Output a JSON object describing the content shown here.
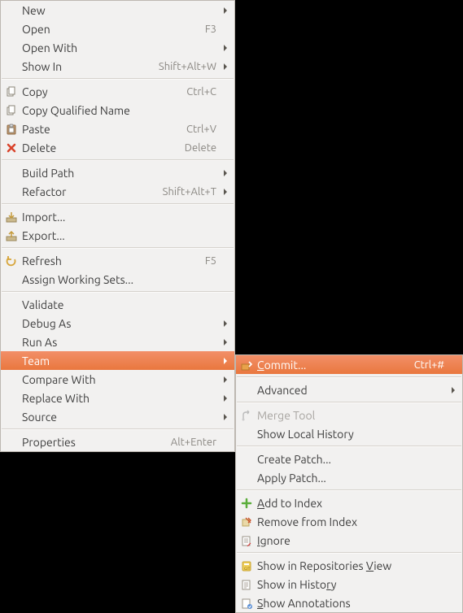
{
  "main_menu": {
    "groups": [
      [
        {
          "id": "new",
          "label": "New",
          "shortcut": "",
          "submenu": true,
          "icon": "",
          "name": "menu-item-new"
        },
        {
          "id": "open",
          "label": "Open",
          "shortcut": "F3",
          "submenu": false,
          "icon": "",
          "name": "menu-item-open"
        },
        {
          "id": "openwith",
          "label": "Open With",
          "shortcut": "",
          "submenu": true,
          "icon": "",
          "name": "menu-item-open-with"
        },
        {
          "id": "showin",
          "label": "Show In",
          "shortcut": "Shift+Alt+W",
          "submenu": true,
          "icon": "",
          "name": "menu-item-show-in"
        }
      ],
      [
        {
          "id": "copy",
          "label": "Copy",
          "shortcut": "Ctrl+C",
          "submenu": false,
          "icon": "copy",
          "name": "menu-item-copy"
        },
        {
          "id": "copyqn",
          "label": "Copy Qualified Name",
          "shortcut": "",
          "submenu": false,
          "icon": "copy",
          "name": "menu-item-copy-qualified-name"
        },
        {
          "id": "paste",
          "label": "Paste",
          "shortcut": "Ctrl+V",
          "submenu": false,
          "icon": "paste",
          "name": "menu-item-paste"
        },
        {
          "id": "delete",
          "label": "Delete",
          "shortcut": "Delete",
          "submenu": false,
          "icon": "delete",
          "name": "menu-item-delete"
        }
      ],
      [
        {
          "id": "buildpath",
          "label": "Build Path",
          "shortcut": "",
          "submenu": true,
          "icon": "",
          "name": "menu-item-build-path"
        },
        {
          "id": "refactor",
          "label": "Refactor",
          "shortcut": "Shift+Alt+T",
          "submenu": true,
          "icon": "",
          "name": "menu-item-refactor"
        }
      ],
      [
        {
          "id": "import",
          "label": "Import...",
          "shortcut": "",
          "submenu": false,
          "icon": "import",
          "name": "menu-item-import"
        },
        {
          "id": "export",
          "label": "Export...",
          "shortcut": "",
          "submenu": false,
          "icon": "export",
          "name": "menu-item-export"
        }
      ],
      [
        {
          "id": "refresh",
          "label": "Refresh",
          "shortcut": "F5",
          "submenu": false,
          "icon": "refresh",
          "name": "menu-item-refresh"
        },
        {
          "id": "aws",
          "label": "Assign Working Sets...",
          "shortcut": "",
          "submenu": false,
          "icon": "",
          "name": "menu-item-assign-working-sets"
        }
      ],
      [
        {
          "id": "validate",
          "label": "Validate",
          "shortcut": "",
          "submenu": false,
          "icon": "",
          "name": "menu-item-validate"
        },
        {
          "id": "debugas",
          "label": "Debug As",
          "shortcut": "",
          "submenu": true,
          "icon": "",
          "name": "menu-item-debug-as"
        },
        {
          "id": "runas",
          "label": "Run As",
          "shortcut": "",
          "submenu": true,
          "icon": "",
          "name": "menu-item-run-as"
        },
        {
          "id": "team",
          "label": "Team",
          "shortcut": "",
          "submenu": true,
          "icon": "",
          "name": "menu-item-team",
          "highlight": true
        },
        {
          "id": "compare",
          "label": "Compare With",
          "shortcut": "",
          "submenu": true,
          "icon": "",
          "name": "menu-item-compare-with"
        },
        {
          "id": "replace",
          "label": "Replace With",
          "shortcut": "",
          "submenu": true,
          "icon": "",
          "name": "menu-item-replace-with"
        },
        {
          "id": "source",
          "label": "Source",
          "shortcut": "",
          "submenu": true,
          "icon": "",
          "name": "menu-item-source"
        }
      ],
      [
        {
          "id": "properties",
          "label": "Properties",
          "shortcut": "Alt+Enter",
          "submenu": false,
          "icon": "",
          "name": "menu-item-properties"
        }
      ]
    ]
  },
  "sub_menu": {
    "groups": [
      [
        {
          "id": "commit",
          "label": "Commit...",
          "mnemonic": "C",
          "shortcut": "Ctrl+#",
          "submenu": false,
          "icon": "commit",
          "name": "menu-item-commit",
          "highlight": true
        }
      ],
      [
        {
          "id": "advanced",
          "label": "Advanced",
          "mnemonic": "",
          "shortcut": "",
          "submenu": true,
          "icon": "",
          "name": "menu-item-advanced"
        }
      ],
      [
        {
          "id": "mergetool",
          "label": "Merge Tool",
          "mnemonic": "",
          "shortcut": "",
          "submenu": false,
          "icon": "merge",
          "name": "menu-item-merge-tool",
          "disabled": true
        },
        {
          "id": "showlocal",
          "label": "Show Local History",
          "mnemonic": "",
          "shortcut": "",
          "submenu": false,
          "icon": "",
          "name": "menu-item-show-local-history"
        }
      ],
      [
        {
          "id": "createpatch",
          "label": "Create Patch...",
          "mnemonic": "",
          "shortcut": "",
          "submenu": false,
          "icon": "",
          "name": "menu-item-create-patch"
        },
        {
          "id": "applypatch",
          "label": "Apply Patch...",
          "mnemonic": "",
          "shortcut": "",
          "submenu": false,
          "icon": "",
          "name": "menu-item-apply-patch"
        }
      ],
      [
        {
          "id": "addindex",
          "label": "Add to Index",
          "mnemonic": "A",
          "shortcut": "",
          "submenu": false,
          "icon": "add",
          "name": "menu-item-add-to-index"
        },
        {
          "id": "removeindex",
          "label": "Remove from Index",
          "mnemonic": "",
          "shortcut": "",
          "submenu": false,
          "icon": "remove",
          "name": "menu-item-remove-from-index"
        },
        {
          "id": "ignore",
          "label": "Ignore",
          "mnemonic": "I",
          "shortcut": "",
          "submenu": false,
          "icon": "ignore",
          "name": "menu-item-ignore"
        }
      ],
      [
        {
          "id": "showrepo",
          "label": "Show in Repositories View",
          "mnemonic": "V",
          "shortcut": "",
          "submenu": false,
          "icon": "repo",
          "name": "menu-item-show-in-repositories-view"
        },
        {
          "id": "showhist",
          "label": "Show in History",
          "mnemonic": "r",
          "shortcut": "",
          "submenu": false,
          "icon": "history",
          "name": "menu-item-show-in-history"
        },
        {
          "id": "showann",
          "label": "Show Annotations",
          "mnemonic": "S",
          "shortcut": "",
          "submenu": false,
          "icon": "annot",
          "name": "menu-item-show-annotations"
        }
      ]
    ]
  },
  "icons": {
    "copy": "copy-icon",
    "paste": "paste-icon",
    "delete": "delete-icon",
    "import": "import-icon",
    "export": "export-icon",
    "refresh": "refresh-icon",
    "commit": "commit-icon",
    "merge": "merge-icon",
    "add": "add-icon",
    "remove": "remove-icon",
    "ignore": "ignore-icon",
    "repo": "repo-icon",
    "history": "history-icon",
    "annot": "annotations-icon"
  }
}
